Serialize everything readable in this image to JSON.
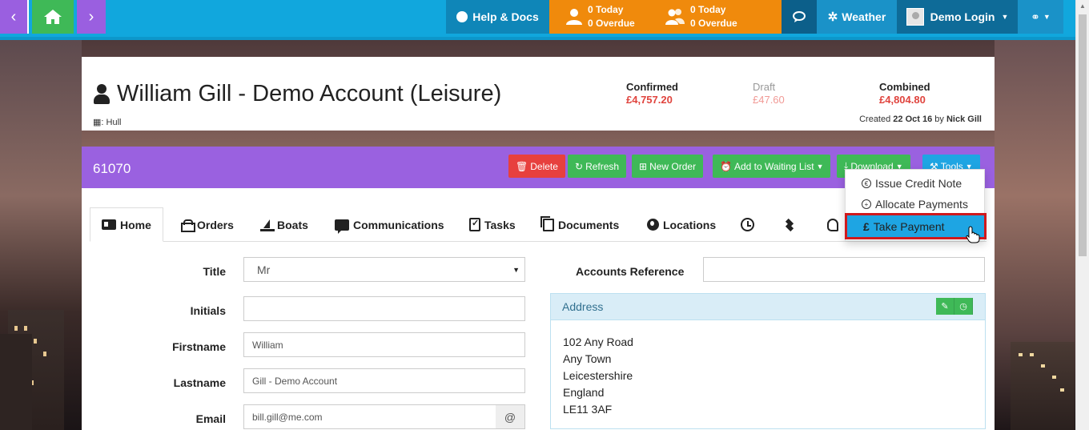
{
  "topbar": {
    "help_label": "Help & Docs",
    "tasks_a": {
      "today": "0 Today",
      "overdue": "0 Overdue"
    },
    "tasks_b": {
      "today": "0 Today",
      "overdue": "0 Overdue"
    },
    "weather_label": "Weather",
    "user_label": "Demo Login",
    "colors": {
      "bar": "#11a7dd",
      "nav_purple": "#9a5fe0",
      "nav_green": "#3fb957",
      "tasks_orange": "#f08a0c"
    }
  },
  "header": {
    "account_name": "William Gill - Demo Account (Leisure)",
    "location": ": Hull",
    "confirmed": {
      "label": "Confirmed",
      "value": "£4,757.20"
    },
    "draft": {
      "label": "Draft",
      "value": "£47.60"
    },
    "combined": {
      "label": "Combined",
      "value": "£4,804.80"
    },
    "created_prefix": "Created",
    "created_date": "22 Oct 16",
    "created_by_prefix": "by",
    "created_by": "Nick Gill"
  },
  "actionbar": {
    "account_id": "61070",
    "buttons": {
      "delete": "Delete",
      "refresh": "Refresh",
      "new_order": "New Order",
      "waiting_list": "Add to Waiting List",
      "download": "Download",
      "tools": "Tools"
    }
  },
  "tabs": [
    "Home",
    "Orders",
    "Boats",
    "Communications",
    "Tasks",
    "Documents",
    "Locations"
  ],
  "form": {
    "title": {
      "label": "Title",
      "value": "Mr"
    },
    "initials": {
      "label": "Initials",
      "value": ""
    },
    "firstname": {
      "label": "Firstname",
      "value": "William"
    },
    "lastname": {
      "label": "Lastname",
      "value": "Gill - Demo Account"
    },
    "email": {
      "label": "Email",
      "value": "bill.gill@me.com",
      "addon": "@"
    },
    "accounts_reference": {
      "label": "Accounts Reference",
      "value": ""
    }
  },
  "address": {
    "heading": "Address",
    "lines": [
      "102 Any Road",
      "Any Town",
      "Leicestershire",
      "England",
      "LE11 3AF"
    ]
  },
  "tools_menu": {
    "items": [
      {
        "label": "Issue Credit Note",
        "icon": "euro-icon"
      },
      {
        "label": "Allocate Payments",
        "icon": "allocate-icon"
      },
      {
        "label": "Take Payment",
        "icon": "pound-icon"
      }
    ],
    "highlighted": "Take Payment"
  }
}
